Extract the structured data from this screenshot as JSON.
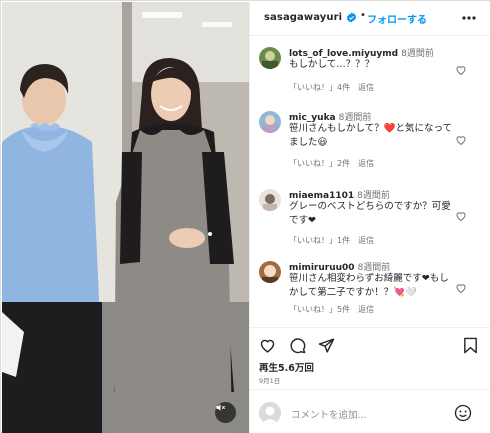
{
  "post": {
    "username": "sasagawayuri",
    "separator": "•",
    "follow_label": "フォローする",
    "views_label": "再生5.6万回",
    "date_label": "9月1日",
    "add_comment_placeholder": "コメントを追加...",
    "like_count_suffix_note": ""
  },
  "comments": [
    {
      "user": "lots_of_love.miyuymd",
      "time": "8週間前",
      "text": "もしかして…？？？",
      "like_label": "「いいね！」4件",
      "reply_label": "返信"
    },
    {
      "user": "mic_yuka",
      "time": "8週間前",
      "text": "笹川さんもしかして？❤️と気になってました😃",
      "like_label": "「いいね！」2件",
      "reply_label": "返信"
    },
    {
      "user": "miaema1101",
      "time": "8週間前",
      "text": "グレーのベストどちらのですか？可愛です❤",
      "like_label": "「いいね！」1件",
      "reply_label": "返信"
    },
    {
      "user": "mimiruruu00",
      "time": "8週間前",
      "text": "笹川さん相変わらずお綺麗です❤もしかして第二子ですか！？💘🤍",
      "like_label": "「いいね！」5件",
      "reply_label": "返信"
    }
  ],
  "icons": {
    "verified": "verified-badge-icon",
    "more": "more-options-icon",
    "heart": "heart-icon",
    "comment": "comment-icon",
    "share": "share-icon",
    "save": "bookmark-icon",
    "emoji": "emoji-icon",
    "mute": "mute-icon"
  },
  "colors": {
    "accent": "#0095f6",
    "muted": "#737373",
    "border": "#efefef"
  }
}
